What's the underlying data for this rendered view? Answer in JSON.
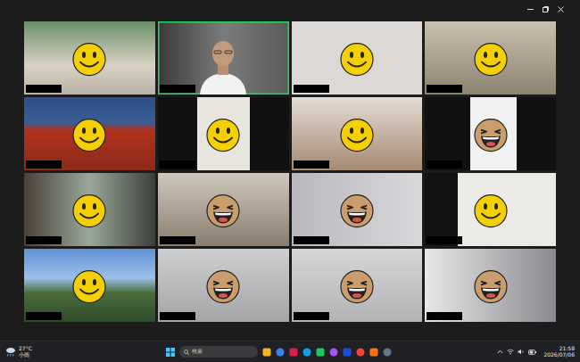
{
  "meeting": {
    "view": "gallery",
    "tiles": [
      {
        "kind": "smile",
        "speaking": false
      },
      {
        "kind": "none",
        "speaking": true
      },
      {
        "kind": "smile",
        "speaking": false
      },
      {
        "kind": "smile",
        "speaking": false
      },
      {
        "kind": "smile",
        "speaking": false
      },
      {
        "kind": "smile",
        "speaking": false
      },
      {
        "kind": "smile",
        "speaking": false
      },
      {
        "kind": "laugh",
        "speaking": false
      },
      {
        "kind": "smile",
        "speaking": false
      },
      {
        "kind": "laugh",
        "speaking": false
      },
      {
        "kind": "laugh",
        "speaking": false
      },
      {
        "kind": "smile",
        "speaking": false
      },
      {
        "kind": "smile",
        "speaking": false
      },
      {
        "kind": "laugh",
        "speaking": false
      },
      {
        "kind": "laugh",
        "speaking": false
      },
      {
        "kind": "laugh",
        "speaking": false
      }
    ]
  },
  "taskbar": {
    "weather": {
      "temperature": "27°C",
      "condition": "小雨"
    },
    "search": {
      "placeholder": "検索"
    },
    "clock": {
      "time": "21:58",
      "date": "2026/07/06"
    }
  }
}
